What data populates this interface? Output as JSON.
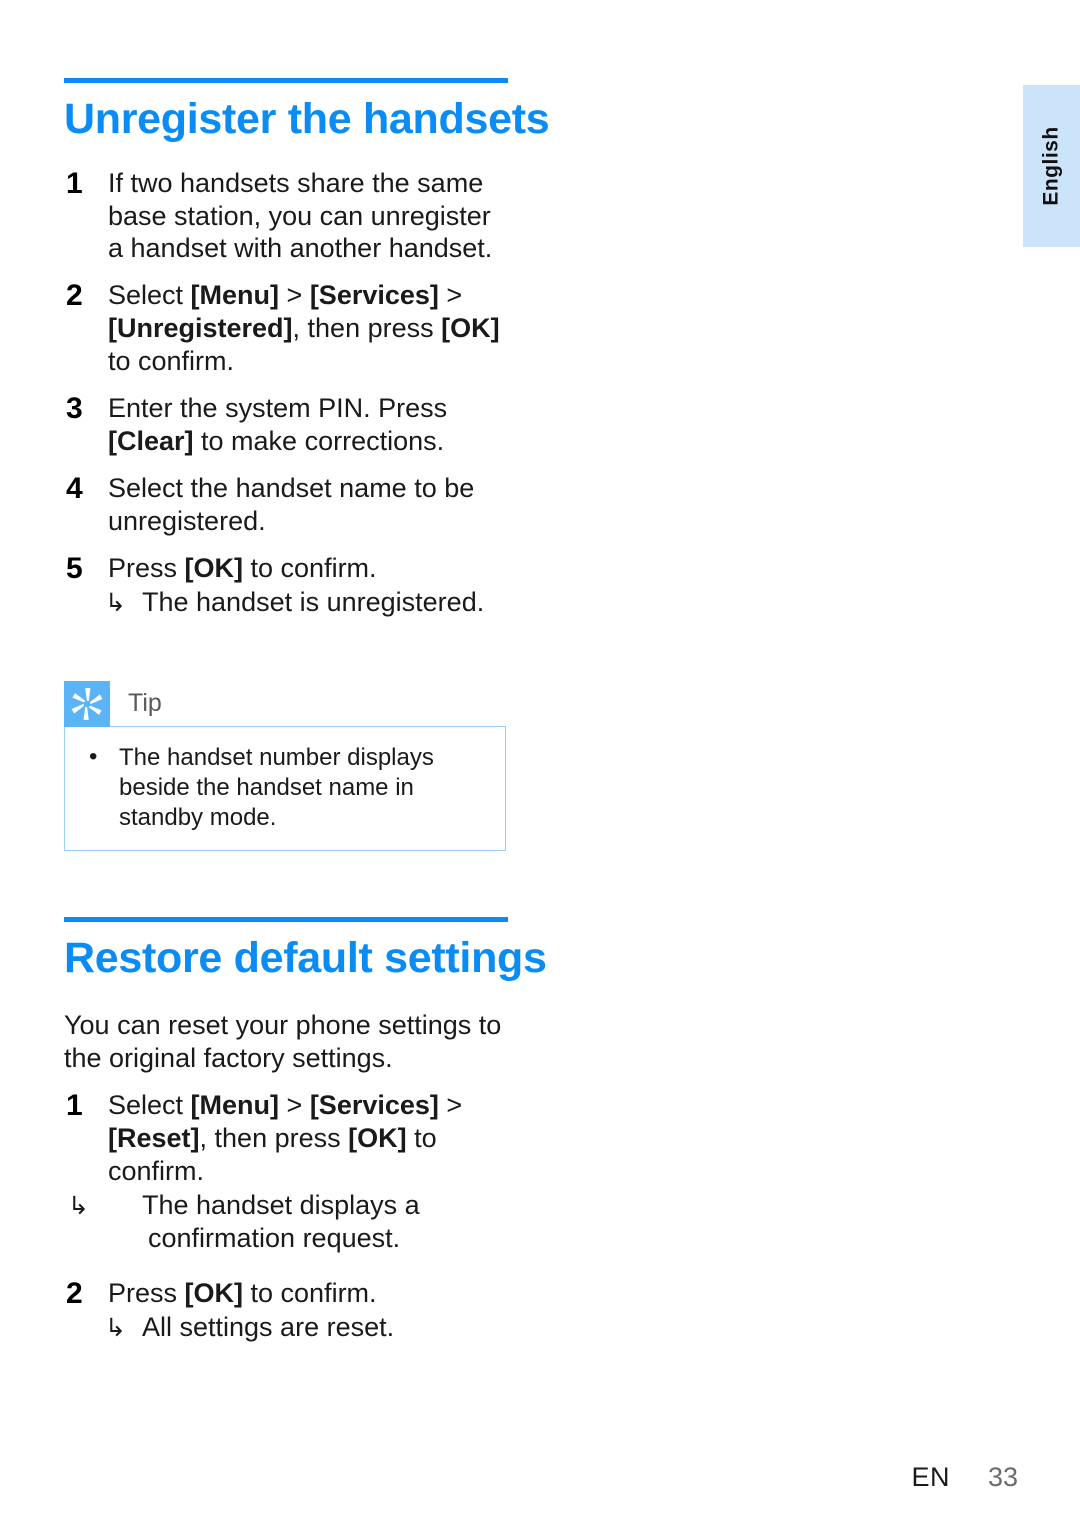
{
  "page": {
    "language_tab": "English",
    "footer": {
      "locale": "EN",
      "page_number": "33"
    },
    "accent_color": "#0b8cf5",
    "tab_color": "#cce4fa"
  },
  "sections": [
    {
      "title": "Unregister the handsets",
      "steps": [
        {
          "number": "1",
          "parts": [
            {
              "t": "If two handsets share the same base station, you can unregister a handset with another handset.",
              "b": false
            }
          ],
          "results": []
        },
        {
          "number": "2",
          "parts": [
            {
              "t": "Select ",
              "b": false
            },
            {
              "t": "[Menu]",
              "b": true
            },
            {
              "t": " > ",
              "b": false
            },
            {
              "t": "[Services]",
              "b": true
            },
            {
              "t": " > ",
              "b": false
            },
            {
              "t": "[Unregistered]",
              "b": true
            },
            {
              "t": ", then press ",
              "b": false
            },
            {
              "t": "[OK]",
              "b": true
            },
            {
              "t": " to confirm.",
              "b": false
            }
          ],
          "results": []
        },
        {
          "number": "3",
          "parts": [
            {
              "t": "Enter the system PIN. Press ",
              "b": false
            },
            {
              "t": "[Clear]",
              "b": true
            },
            {
              "t": " to make corrections.",
              "b": false
            }
          ],
          "results": []
        },
        {
          "number": "4",
          "parts": [
            {
              "t": "Select the handset name to be unregistered.",
              "b": false
            }
          ],
          "results": []
        },
        {
          "number": "5",
          "parts": [
            {
              "t": "Press ",
              "b": false
            },
            {
              "t": "[OK]",
              "b": true
            },
            {
              "t": " to confirm.",
              "b": false
            }
          ],
          "results": [
            "The handset is unregistered."
          ]
        }
      ],
      "tip": {
        "label": "Tip",
        "icon": "tip-asterisk-icon",
        "items": [
          "The handset number displays beside the handset name in standby mode."
        ]
      }
    },
    {
      "title": "Restore default settings",
      "intro": "You can reset your phone settings to the original factory settings.",
      "steps": [
        {
          "number": "1",
          "parts": [
            {
              "t": "Select ",
              "b": false
            },
            {
              "t": "[Menu]",
              "b": true
            },
            {
              "t": " > ",
              "b": false
            },
            {
              "t": "[Services]",
              "b": true
            },
            {
              "t": " > ",
              "b": false
            },
            {
              "t": "[Reset]",
              "b": true
            },
            {
              "t": ", then press ",
              "b": false
            },
            {
              "t": "[OK]",
              "b": true
            },
            {
              "t": " to confirm.",
              "b": false
            }
          ],
          "results": [
            "The handset displays a confirmation request."
          ]
        },
        {
          "number": "2",
          "parts": [
            {
              "t": "Press ",
              "b": false
            },
            {
              "t": "[OK]",
              "b": true
            },
            {
              "t": " to confirm.",
              "b": false
            }
          ],
          "results": [
            "All settings are reset."
          ]
        }
      ]
    }
  ],
  "glyphs": {
    "result_arrow": "↳",
    "bullet": "•"
  }
}
